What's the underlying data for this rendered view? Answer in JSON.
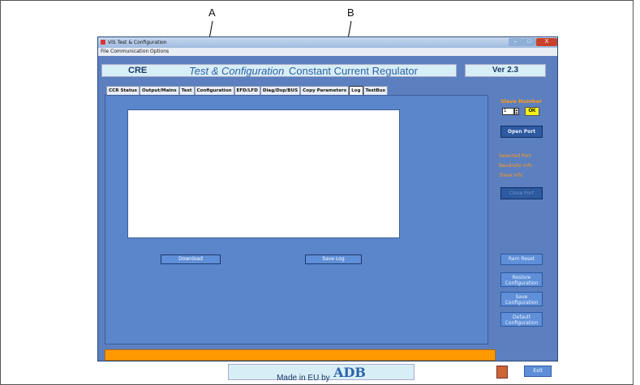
{
  "callouts": {
    "a": "A",
    "b": "B"
  },
  "window": {
    "title": "VIS Test & Configuration",
    "controls": {
      "minimize": "–",
      "maximize": "□",
      "close": "X"
    }
  },
  "menu": {
    "items": [
      "File",
      "Communication",
      "Options"
    ]
  },
  "header": {
    "product": "CRE",
    "title": "Test & Configuration",
    "subtitle": "Constant Current Regulator",
    "version": "Ver 2.3"
  },
  "tabs": [
    {
      "label": "CCR Status"
    },
    {
      "label": "Output/Mains"
    },
    {
      "label": "Test"
    },
    {
      "label": "Configuration"
    },
    {
      "label": "EFD/LFD"
    },
    {
      "label": "Diag/Dsp/BUS"
    },
    {
      "label": "Copy Parameters"
    },
    {
      "label": "Log",
      "active": true
    },
    {
      "label": "TestBus"
    }
  ],
  "log_panel": {
    "download_label": "Download",
    "save_log_label": "Save Log"
  },
  "side": {
    "slave_number_label": "Slave Number",
    "slave_value": "1",
    "ok_label": "OK",
    "open_port_label": "Open Port",
    "status_1": "Selected Port",
    "status_2": "Baudrate Info",
    "status_3": "Slave Info",
    "close_port_label": "Close Port",
    "buttons": {
      "ram_reset": "Ram Reset",
      "restore_1": "Restore",
      "restore_2": "Configuration",
      "save_1": "Save",
      "save_2": "Configuration",
      "default_1": "Default",
      "default_2": "Configuration"
    }
  },
  "footer": {
    "made_in": "Made in EU by",
    "brand": "ADB",
    "exit_label": "Exit"
  },
  "colors": {
    "panel_blue": "#5b86cc",
    "accent_orange": "#ff9900",
    "ok_yellow": "#f2f21a"
  }
}
